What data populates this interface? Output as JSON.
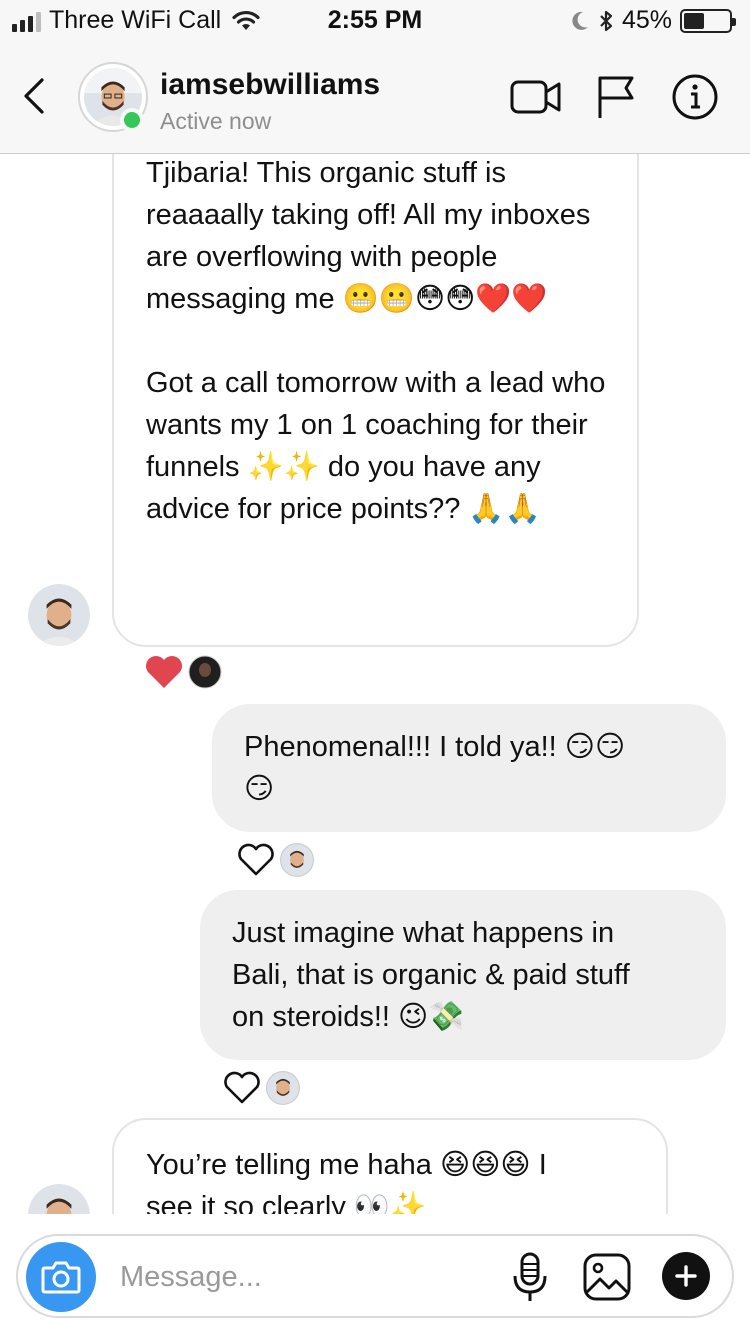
{
  "status_bar": {
    "carrier": "Three WiFi Call",
    "time": "2:55 PM",
    "battery_percent": "45%",
    "battery_level": 0.45
  },
  "header": {
    "username": "iamsebwilliams",
    "status": "Active now",
    "icons": [
      "back-chevron-icon",
      "video-call-icon",
      "flag-icon",
      "info-icon"
    ]
  },
  "messages": [
    {
      "direction": "incoming",
      "paragraphs": [
        "Tjibaria! This organic stuff is reaaaally taking off! All my inboxes are overflowing with people messaging me 😬😬😳😳❤️❤️",
        "Got a call tomorrow with a lead who wants my 1 on 1 coaching for their funnels ✨✨ do you have any advice for price points?? 🙏🙏"
      ],
      "reaction": "heart"
    },
    {
      "direction": "outgoing",
      "text_1": "Phenomenal!!! I told ya!! 😏😏",
      "text_2": "😏",
      "reaction": "heart-outline"
    },
    {
      "direction": "outgoing",
      "line_1": "Just imagine what happens in",
      "line_2": "Bali, that is organic & paid stuff",
      "line_3": "on steroids!! 😉💸",
      "reaction": "heart-outline"
    },
    {
      "direction": "incoming",
      "line_1": "You’re telling me haha 😆😆😆 I",
      "line_2": "see it so clearly 👀✨"
    }
  ],
  "composer": {
    "placeholder": "Message...",
    "icons": [
      "camera-icon",
      "microphone-icon",
      "gallery-icon",
      "plus-icon"
    ]
  },
  "colors": {
    "accent_blue": "#3897f0",
    "online_green": "#35c759",
    "heart_red": "#e0464f",
    "bubble_out": "#efefef"
  }
}
